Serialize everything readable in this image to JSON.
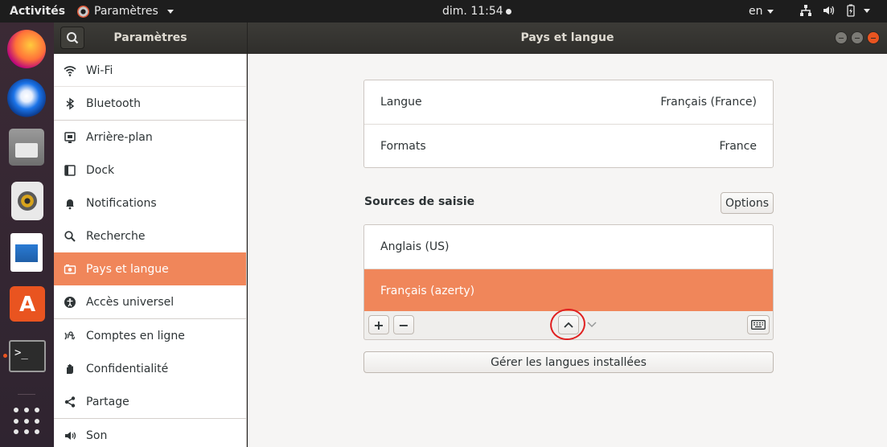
{
  "topbar": {
    "activities": "Activités",
    "app_name": "Paramètres",
    "clock": "dim. 11:54",
    "input_lang": "en"
  },
  "dock": {
    "items": [
      {
        "name": "firefox-icon"
      },
      {
        "name": "thunderbird-icon"
      },
      {
        "name": "files-icon"
      },
      {
        "name": "rhythmbox-icon"
      },
      {
        "name": "libreoffice-writer-icon"
      },
      {
        "name": "software-store-icon"
      },
      {
        "name": "terminal-icon"
      },
      {
        "name": "show-applications-icon"
      }
    ]
  },
  "header": {
    "sidebar_title": "Paramètres",
    "page_title": "Pays et langue"
  },
  "sidebar": {
    "items": [
      {
        "label": "Wi-Fi",
        "icon": "wifi-icon"
      },
      {
        "label": "Bluetooth",
        "icon": "bluetooth-icon"
      },
      {
        "label": "Arrière-plan",
        "icon": "background-icon"
      },
      {
        "label": "Dock",
        "icon": "dock-icon"
      },
      {
        "label": "Notifications",
        "icon": "bell-icon"
      },
      {
        "label": "Recherche",
        "icon": "search-icon"
      },
      {
        "label": "Pays et langue",
        "icon": "region-language-icon",
        "active": true
      },
      {
        "label": "Accès universel",
        "icon": "accessibility-icon"
      },
      {
        "label": "Comptes en ligne",
        "icon": "online-accounts-icon"
      },
      {
        "label": "Confidentialité",
        "icon": "privacy-hand-icon"
      },
      {
        "label": "Partage",
        "icon": "share-icon"
      },
      {
        "label": "Son",
        "icon": "speaker-icon"
      }
    ]
  },
  "region": {
    "language_label": "Langue",
    "language_value": "Français (France)",
    "formats_label": "Formats",
    "formats_value": "France"
  },
  "input_sources": {
    "title": "Sources de saisie",
    "options_label": "Options",
    "sources": [
      "Anglais (US)",
      "Français (azerty)"
    ],
    "selected": "Français (azerty)",
    "add_label": "+",
    "remove_label": "−",
    "manage_label": "Gérer les langues installées"
  },
  "colors": {
    "accent": "#f0865a",
    "ubuntu_orange": "#e95420",
    "annotation": "#e02020"
  }
}
